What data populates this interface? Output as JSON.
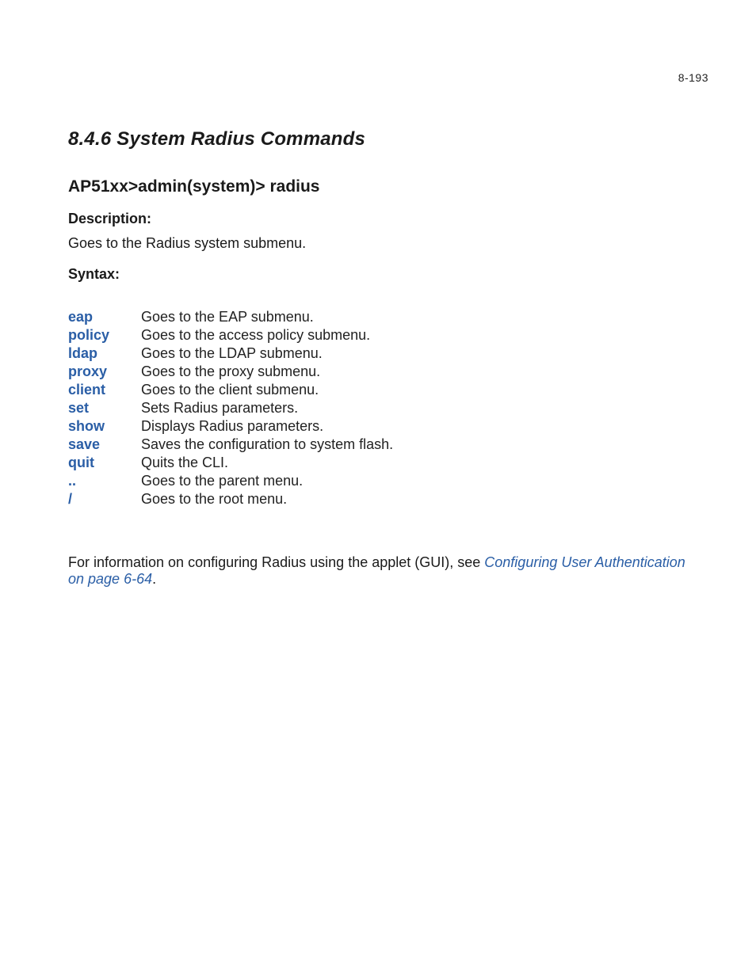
{
  "page_number": "8-193",
  "section_title": "8.4.6  System Radius Commands",
  "prompt_line": "AP51xx>admin(system)> radius",
  "description_heading": "Description:",
  "description_text": "Goes to the Radius system submenu.",
  "syntax_heading": "Syntax:",
  "syntax_rows": [
    {
      "cmd": "eap",
      "desc": "Goes to the EAP submenu."
    },
    {
      "cmd": "policy",
      "desc": "Goes to the access policy submenu."
    },
    {
      "cmd": "ldap",
      "desc": "Goes to the LDAP submenu."
    },
    {
      "cmd": "proxy",
      "desc": "Goes to the proxy submenu."
    },
    {
      "cmd": "client",
      "desc": "Goes to the client submenu."
    },
    {
      "cmd": "set",
      "desc": "Sets Radius parameters."
    },
    {
      "cmd": "show",
      "desc": "Displays Radius parameters."
    },
    {
      "cmd": "save",
      "desc": "Saves the configuration to system flash."
    },
    {
      "cmd": "quit",
      "desc": "Quits the CLI."
    },
    {
      "cmd": "..",
      "desc": "Goes to the parent menu."
    },
    {
      "cmd": "/",
      "desc": "Goes to the root menu."
    }
  ],
  "footer_note_prefix": "For information on configuring Radius using the applet (GUI), see ",
  "footer_note_link": "Configuring User Authentication on page 6-64",
  "footer_note_suffix": "."
}
